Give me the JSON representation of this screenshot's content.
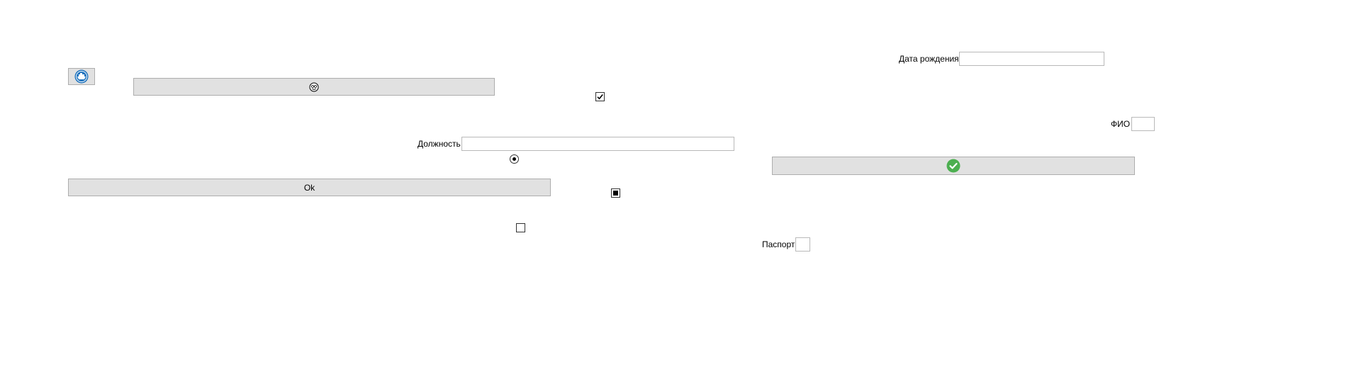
{
  "icons": {
    "ship_icon": "ship-icon",
    "face_icon": "smiley-face-icon",
    "check_icon": "green-checkmark-icon"
  },
  "colors": {
    "button_bg": "#e1e1e1",
    "button_border": "#adadad",
    "ship_circle": "#1e73be",
    "check_green": "#4caf50"
  },
  "form": {
    "birthdate_label": "Дата рождения",
    "birthdate_value": "",
    "fio_label": "ФИО",
    "fio_value": "",
    "position_label": "Должность",
    "position_value": "",
    "passport_label": "Паспорт",
    "passport_value": ""
  },
  "buttons": {
    "ok_label": "Ok"
  },
  "controls": {
    "checkbox_checked": true,
    "radio_selected": true,
    "checkbox_indeterminate": true,
    "checkbox_empty": false
  }
}
